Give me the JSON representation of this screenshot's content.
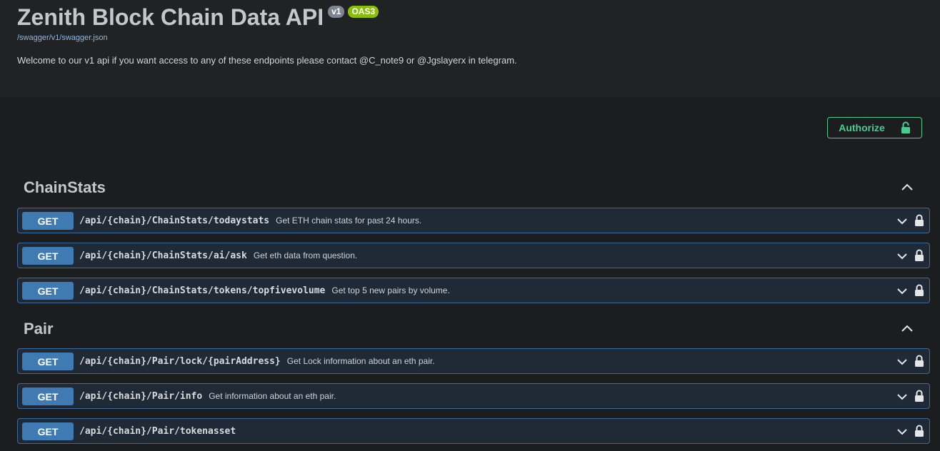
{
  "info": {
    "title": "Zenith Block Chain Data API",
    "version_badge": "v1",
    "oas_badge": "OAS3",
    "spec_link": "/swagger/v1/swagger.json",
    "description": "Welcome to our v1 api if you want access to any of these endpoints please contact @C_note9 or @Jgslayerx in telegram."
  },
  "authorize": {
    "label": "Authorize"
  },
  "tags": [
    {
      "name": "ChainStats",
      "operations": [
        {
          "method": "GET",
          "path": "/api/{chain}/ChainStats/todaystats",
          "summary": "Get ETH chain stats for past 24 hours."
        },
        {
          "method": "GET",
          "path": "/api/{chain}/ChainStats/ai/ask",
          "summary": "Get eth data from question."
        },
        {
          "method": "GET",
          "path": "/api/{chain}/ChainStats/tokens/topfivevolume",
          "summary": "Get top 5 new pairs by volume."
        }
      ]
    },
    {
      "name": "Pair",
      "operations": [
        {
          "method": "GET",
          "path": "/api/{chain}/Pair/lock/{pairAddress}",
          "summary": "Get Lock information about an eth pair."
        },
        {
          "method": "GET",
          "path": "/api/{chain}/Pair/info",
          "summary": "Get information about an eth pair."
        },
        {
          "method": "GET",
          "path": "/api/{chain}/Pair/tokenasset",
          "summary": ""
        }
      ]
    }
  ],
  "colors": {
    "accent_green": "#49cc90",
    "get_blue": "#3f7ab3"
  },
  "icons": {
    "authorize": "unlocked-padlock-icon",
    "tag_toggle": "chevron-up-icon",
    "op_toggle": "chevron-down-icon",
    "op_auth": "padlock-icon"
  }
}
